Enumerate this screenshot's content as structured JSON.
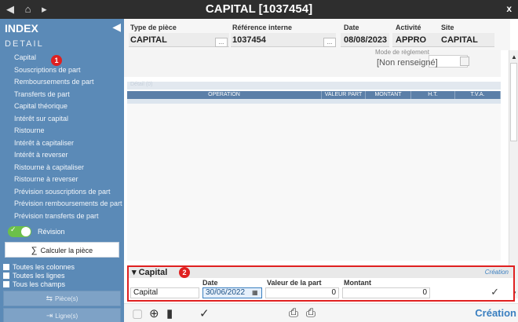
{
  "titlebar": {
    "title": "CAPITAL [1037454]",
    "back_icon": "back-arrow-icon",
    "home_icon": "home-icon",
    "forward_icon": "forward-arrow-icon",
    "close_label": "x"
  },
  "sidebar": {
    "heading": "INDEX",
    "section": "DETAIL",
    "badge": "1",
    "items": [
      {
        "label": "Capital"
      },
      {
        "label": "Souscriptions de part"
      },
      {
        "label": "Remboursements de part"
      },
      {
        "label": "Transferts de part"
      },
      {
        "label": "Capital théorique"
      },
      {
        "label": "Intérêt sur capital"
      },
      {
        "label": "Ristourne"
      },
      {
        "label": "Intérêt à capitaliser"
      },
      {
        "label": "Intérêt à reverser"
      },
      {
        "label": "Ristourne à capitaliser"
      },
      {
        "label": "Ristourne à reverser"
      },
      {
        "label": "Prévision souscriptions de part"
      },
      {
        "label": "Prévision remboursements de part"
      },
      {
        "label": "Prévision transferts de part"
      }
    ],
    "revision_label": "Révision",
    "calc_label": "Calculer la pièce",
    "checks": [
      {
        "label": "Toutes les colonnes"
      },
      {
        "label": "Toutes les lignes"
      },
      {
        "label": "Tous les champs"
      }
    ],
    "piece_btn": "Pièce(s)",
    "ligne_btn": "Ligne(s)"
  },
  "header": {
    "type_label": "Type de pièce",
    "type_value": "CAPITAL",
    "ref_label": "Référence interne",
    "ref_value": "1037454",
    "date_label": "Date",
    "date_value": "08/08/2023",
    "activite_label": "Activité",
    "activite_value": "APPRO",
    "site_label": "Site",
    "site_value": "CAPITAL",
    "dots": "..."
  },
  "mode": {
    "label": "Mode de règlement",
    "value": "[Non renseigné]"
  },
  "grid": {
    "caption": "Détail (0)",
    "columns": [
      "OPERATION",
      "VALEUR PART",
      "MONTANT",
      "H.T.",
      "T.V.A."
    ]
  },
  "capital_panel": {
    "title": "Capital",
    "badge": "2",
    "mode": "Création",
    "row_label": "Capital",
    "date_label": "Date",
    "date_value": "30/06/2022",
    "valeur_label": "Valeur de la part",
    "valeur_value": "0",
    "montant_label": "Montant",
    "montant_value": "0"
  },
  "toolbar": {
    "creation_label": "Création"
  }
}
